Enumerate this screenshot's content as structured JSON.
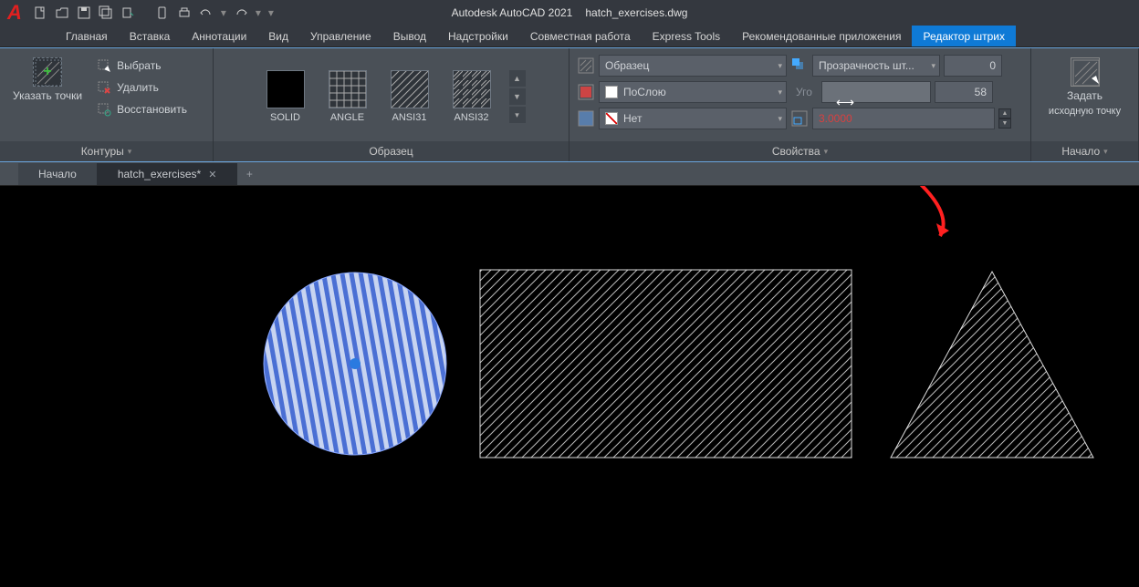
{
  "titlebar": {
    "app_name": "Autodesk AutoCAD 2021",
    "file_name": "hatch_exercises.dwg"
  },
  "menubar": {
    "items": [
      {
        "label": "Главная"
      },
      {
        "label": "Вставка"
      },
      {
        "label": "Аннотации"
      },
      {
        "label": "Вид"
      },
      {
        "label": "Управление"
      },
      {
        "label": "Вывод"
      },
      {
        "label": "Надстройки"
      },
      {
        "label": "Совместная работа"
      },
      {
        "label": "Express Tools"
      },
      {
        "label": "Рекомендованные приложения"
      },
      {
        "label": "Редактор штрих"
      }
    ]
  },
  "ribbon": {
    "boundaries": {
      "pick_points": "Указать точки",
      "select": "Выбрать",
      "delete": "Удалить",
      "restore": "Восстановить",
      "panel_label": "Контуры"
    },
    "pattern": {
      "swatches": [
        {
          "name": "SOLID"
        },
        {
          "name": "ANGLE"
        },
        {
          "name": "ANSI31"
        },
        {
          "name": "ANSI32"
        }
      ],
      "panel_label": "Образец"
    },
    "properties": {
      "pattern_label": "Образец",
      "bylayer": "ПоСлою",
      "none": "Нет",
      "transparency_label": "Прозрачность шт...",
      "transparency_value": "0",
      "angle_label": "Уго",
      "angle_value": "58",
      "scale_value": "3.0000",
      "panel_label": "Свойства"
    },
    "origin": {
      "main": "Задать",
      "sub": "исходную точку",
      "panel_label": "Начало"
    }
  },
  "filetabs": {
    "start": "Начало",
    "file": "hatch_exercises*"
  }
}
